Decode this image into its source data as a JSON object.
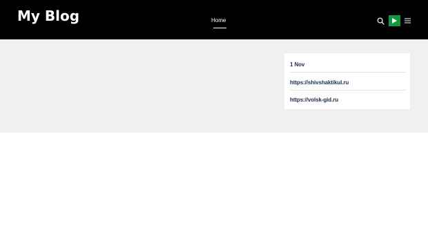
{
  "header": {
    "site_title": "My Blog",
    "nav": [
      {
        "label": "Home",
        "active": true
      }
    ],
    "icons": {
      "search": "search-icon",
      "play": "play-icon",
      "menu": "hamburger-menu-icon"
    },
    "accent_color": "#129940",
    "background_color": "#000000"
  },
  "sidebar_widget": {
    "items": [
      {
        "label": "1 Nov"
      },
      {
        "label": "https://shivshaktikul.ru"
      },
      {
        "label": "https://volsk-gid.ru"
      }
    ]
  }
}
